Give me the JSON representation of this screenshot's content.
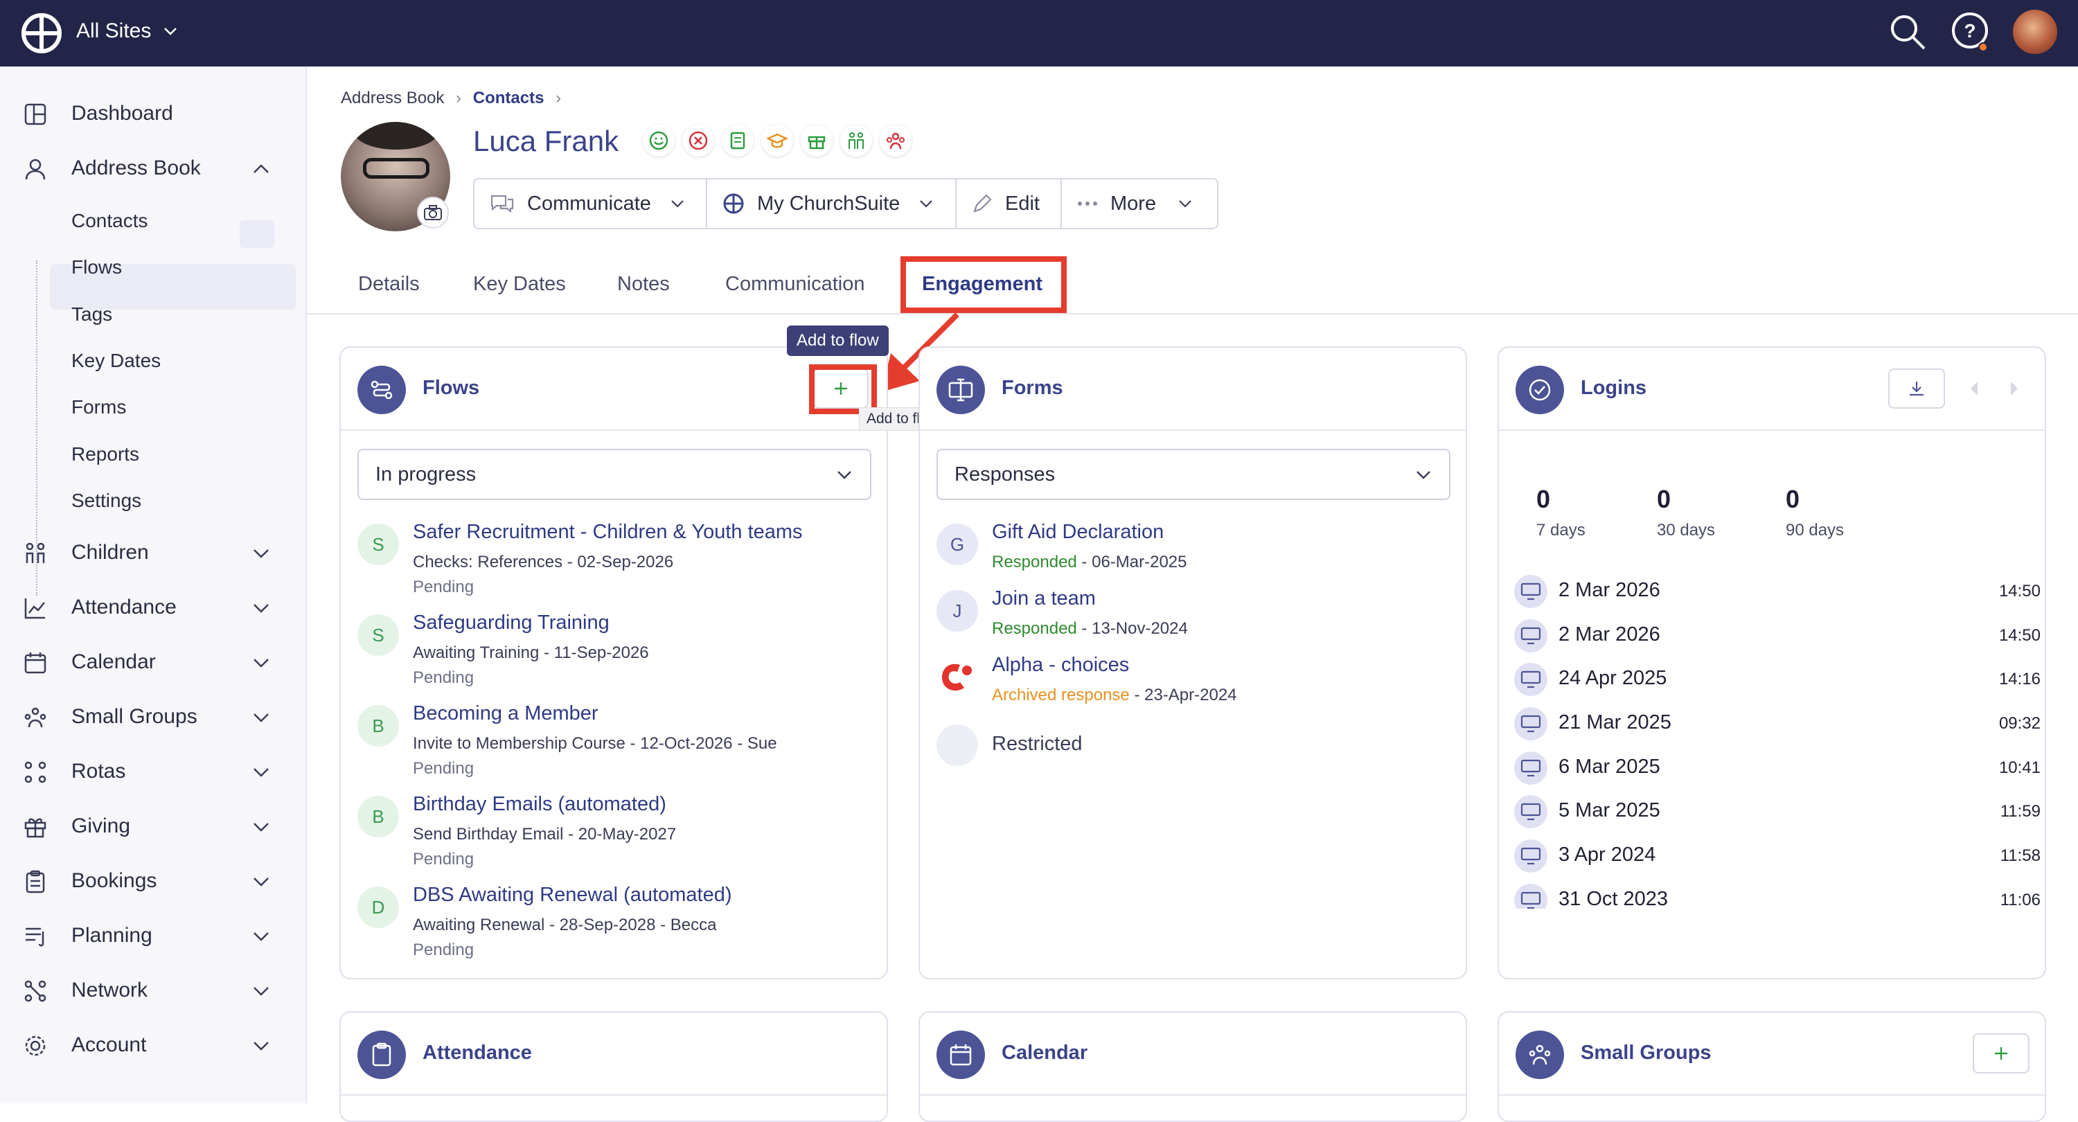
{
  "topbar": {
    "site_label": "All Sites"
  },
  "sidebar": {
    "items": [
      {
        "label": "Dashboard"
      },
      {
        "label": "Address Book"
      },
      {
        "label": "Children"
      },
      {
        "label": "Attendance"
      },
      {
        "label": "Calendar"
      },
      {
        "label": "Small Groups"
      },
      {
        "label": "Rotas"
      },
      {
        "label": "Giving"
      },
      {
        "label": "Bookings"
      },
      {
        "label": "Planning"
      },
      {
        "label": "Network"
      },
      {
        "label": "Account"
      }
    ],
    "sub_items": [
      {
        "label": "Contacts"
      },
      {
        "label": "Flows"
      },
      {
        "label": "Tags"
      },
      {
        "label": "Key Dates"
      },
      {
        "label": "Forms"
      },
      {
        "label": "Reports"
      },
      {
        "label": "Settings"
      }
    ]
  },
  "breadcrumb": {
    "first": "Address Book",
    "second": "Contacts"
  },
  "profile": {
    "name": "Luca Frank"
  },
  "actions": {
    "communicate": "Communicate",
    "churchsuite": "My ChurchSuite",
    "edit": "Edit",
    "more": "More"
  },
  "tabs": [
    {
      "label": "Details"
    },
    {
      "label": "Key Dates"
    },
    {
      "label": "Notes"
    },
    {
      "label": "Communication"
    },
    {
      "label": "Engagement"
    }
  ],
  "flows": {
    "title": "Flows",
    "tooltip": "Add to flow",
    "tooltip_hover": "Add to flow",
    "filter": "In progress",
    "items": [
      {
        "initial": "S",
        "title": "Safer Recruitment - Children & Youth teams",
        "sub": "Checks: References - 02-Sep-2026",
        "status": "Pending"
      },
      {
        "initial": "S",
        "title": "Safeguarding Training",
        "sub": "Awaiting Training - 11-Sep-2026",
        "status": "Pending"
      },
      {
        "initial": "B",
        "title": "Becoming a Member",
        "sub": "Invite to Membership Course - 12-Oct-2026 - Sue",
        "status": "Pending"
      },
      {
        "initial": "B",
        "title": "Birthday Emails (automated)",
        "sub": "Send Birthday Email - 20-May-2027",
        "status": "Pending"
      },
      {
        "initial": "D",
        "title": "DBS Awaiting Renewal (automated)",
        "sub": "Awaiting Renewal - 28-Sep-2028 - Becca",
        "status": "Pending"
      }
    ]
  },
  "forms": {
    "title": "Forms",
    "filter": "Responses",
    "items": [
      {
        "initial": "G",
        "title": "Gift Aid Declaration",
        "state": "Responded",
        "date": " - 06-Mar-2025"
      },
      {
        "initial": "J",
        "title": "Join a team",
        "state": "Responded",
        "date": " - 13-Nov-2024"
      },
      {
        "initial": "",
        "title": "Alpha - choices",
        "state": "Archived response",
        "date": " - 23-Apr-2024"
      },
      {
        "initial": "",
        "title": "Restricted"
      }
    ]
  },
  "logins": {
    "title": "Logins",
    "stats": [
      {
        "value": "0",
        "label": "7 days"
      },
      {
        "value": "0",
        "label": "30 days"
      },
      {
        "value": "0",
        "label": "90 days"
      }
    ],
    "entries": [
      {
        "date": "2 Mar 2026",
        "time": "14:50"
      },
      {
        "date": "2 Mar 2026",
        "time": "14:50"
      },
      {
        "date": "24 Apr 2025",
        "time": "14:16"
      },
      {
        "date": "21 Mar 2025",
        "time": "09:32"
      },
      {
        "date": "6 Mar 2025",
        "time": "10:41"
      },
      {
        "date": "5 Mar 2025",
        "time": "11:59"
      },
      {
        "date": "3 Apr 2024",
        "time": "11:58"
      },
      {
        "date": "31 Oct 2023",
        "time": "11:06"
      }
    ]
  },
  "bottom_cards": {
    "attendance": "Attendance",
    "calendar": "Calendar",
    "small_groups": "Small Groups"
  },
  "colors": {
    "nav": "#232548",
    "accent": "#2e3a85",
    "highlight": "#e43d2e",
    "icon_circle": "#4c5496"
  }
}
